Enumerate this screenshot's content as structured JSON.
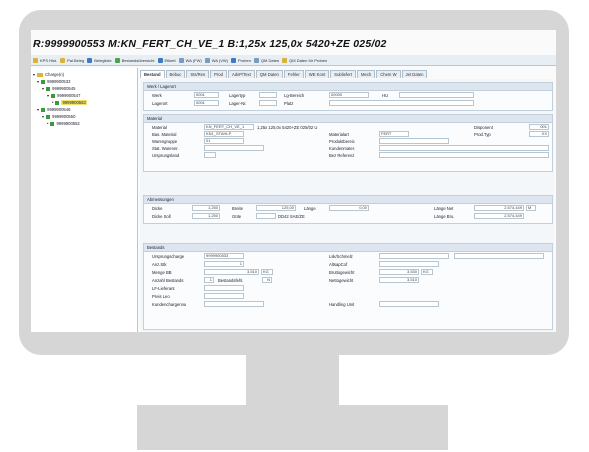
{
  "window": {
    "title": "R:9999900553  M:KN_FERT_CH_VE_1  B:1,25x 125,0x    5420+ZE 025/02"
  },
  "toolbar": {
    "items": [
      {
        "label": "KPS Hist.",
        "icon": "history-icon"
      },
      {
        "label": "Pal.Beleg",
        "icon": "pallet-icon"
      },
      {
        "label": "Belegliste",
        "icon": "list-icon"
      },
      {
        "label": "Bestandsübersicht",
        "icon": "stock-icon"
      },
      {
        "label": "Etikett",
        "icon": "label-icon"
      },
      {
        "label": "WA (FW)",
        "icon": "print-icon"
      },
      {
        "label": "WA (VW)",
        "icon": "print-icon"
      },
      {
        "label": "Proben",
        "icon": "sample-icon"
      },
      {
        "label": "QM Daten",
        "icon": "qm-icon"
      },
      {
        "label": "QM Daten für Proben",
        "icon": "qm-icon"
      }
    ]
  },
  "tree": {
    "root": "Charge(n)",
    "items": [
      "9999900533",
      "9999900545",
      "9999900547",
      "9999900553",
      "9999900546",
      "9999900550",
      "9999900552"
    ]
  },
  "tabs": [
    "Bestand",
    "Bebuc",
    "Sts/Res",
    "Prod",
    "AdvP/Text",
    "QM Daten",
    "Fehler",
    "WE Kont",
    "Subliefert",
    "Mech",
    "Chem W",
    "Jet Daten"
  ],
  "werk_lagerort": {
    "title": "Werk / Lagerort",
    "werk_label": "Werk",
    "werk_value": "0001",
    "lagertyp_label": "Lagertyp",
    "lgbereich_label": "Lg-Bereich",
    "lgbereich_value": "00000",
    "hu_label": "HU",
    "lagerort_label": "Lagerort",
    "lagerort_value": "0001",
    "lagernr_label": "Lager-Nr.",
    "platz_label": "Platz"
  },
  "material": {
    "title": "Material",
    "material_label": "Material",
    "material_value": "KN_FERT_CH_VE_1",
    "material_desc": "1,25x 125,0x    5420+ZE 025/02   U",
    "disponent_label": "Disponent",
    "disponent_value": "001",
    "basis_label": "Bas. Material",
    "basis_value": "KN1_STAHLP",
    "materialart_label": "Materialart",
    "materialart_value": "FERT",
    "prodtyp_label": "Prod.Typ",
    "prodtyp_value": "XX",
    "warengruppe_label": "Warengruppe",
    "warengruppe_value": "01",
    "produktbereich_label": "Produktbereic",
    "statwarenn_label": "Stat. Warennr.",
    "kundenmaterial_label": "Kundenmater.",
    "ursprungsland_label": "Ursprungsland",
    "bezreferenz_label": "Bez Referenz"
  },
  "abmessungen": {
    "title": "Abmessungen",
    "dicke_label": "Dicke",
    "dicke_value": "1,250",
    "breite_label": "Breite",
    "breite_value": "125,00",
    "laenge_label": "Länge",
    "laenge_value": "0,00",
    "laenge_netto_label": "Länge Net",
    "laenge_netto_value": "2.574,449",
    "laenge_netto_unit": "M",
    "dicke_soll_label": "Dicke Soll",
    "dicke_soll_value": "1,250",
    "guete_label": "Güte",
    "guete_value": "DD42 SAE/ZE",
    "laenge_brutto_label": "Länge Bru.",
    "laenge_brutto_value": "2.574,449"
  },
  "bestands": {
    "title": "Bestands",
    "ursprungscharge_label": "Ursprungscharge",
    "ursprungscharge_value": "9999900533",
    "lsk_label": "Lsk/Schmelz",
    "anz_label": "Anz.Stk",
    "anz_value": "1",
    "altsap_label": "AltsapCof",
    "menge_label": "Menge BB",
    "menge_value": "3,510",
    "menge_unit": "KG",
    "brutto_label": "Bruttogewicht",
    "brutto_value": "3,530",
    "brutto_unit": "KG",
    "anzahl_label": "Anzahl Bestands",
    "anzahl_value": "1",
    "bestandsfehl_label": "Bestandsfehl.",
    "bestandsfehl_value": "N",
    "netto_label": "Nettogewicht",
    "netto_value": "3,510",
    "lflieferant_label": "LF-Lieferant",
    "preis_label": "Preis Leo",
    "kundenauftrag_label": "Kundenchargennu",
    "handling_label": "Handling Unit"
  }
}
